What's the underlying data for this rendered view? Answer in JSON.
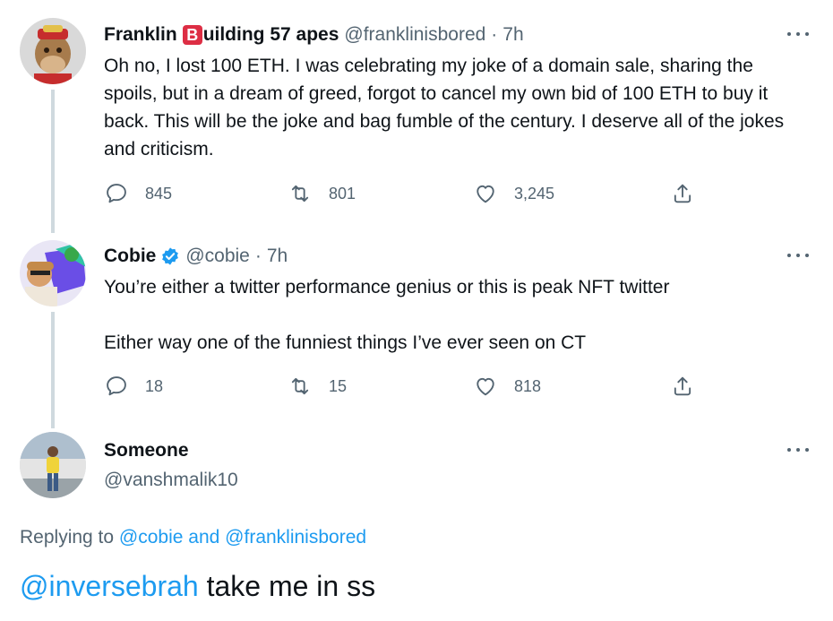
{
  "tweets": [
    {
      "name": "Franklin",
      "name_suffix": "uilding 57 apes",
      "name_badge": "B",
      "handle": "@franklinisbored",
      "dot": "·",
      "time": "7h",
      "text": "Oh no, I lost 100 ETH. I was celebrating my joke of a domain sale, sharing the spoils, but in a dream of greed, forgot to cancel my own bid of 100 ETH to buy it back. This will be the joke and bag fumble of the century. I deserve all of the jokes and criticism.",
      "replies": "845",
      "retweets": "801",
      "likes": "3,245"
    },
    {
      "name": "Cobie",
      "verified": true,
      "handle": "@cobie",
      "dot": "·",
      "time": "7h",
      "text_line1": "You’re either a twitter performance genius or this is peak NFT twitter",
      "text_line2": "Either way one of the funniest things I’ve ever seen on CT",
      "replies": "18",
      "retweets": "15",
      "likes": "818"
    },
    {
      "name": "Someone",
      "handle": "@vanshmalik10"
    }
  ],
  "replying": {
    "prefix": "Replying to",
    "user1": "@cobie",
    "conj": "and",
    "user2": "@franklinisbored"
  },
  "reply": {
    "mention": "@inversebrah",
    "text": " take me in ss"
  },
  "colors": {
    "accent": "#1d9bf0",
    "muted": "#536471",
    "badge_red": "#dd2e44"
  }
}
